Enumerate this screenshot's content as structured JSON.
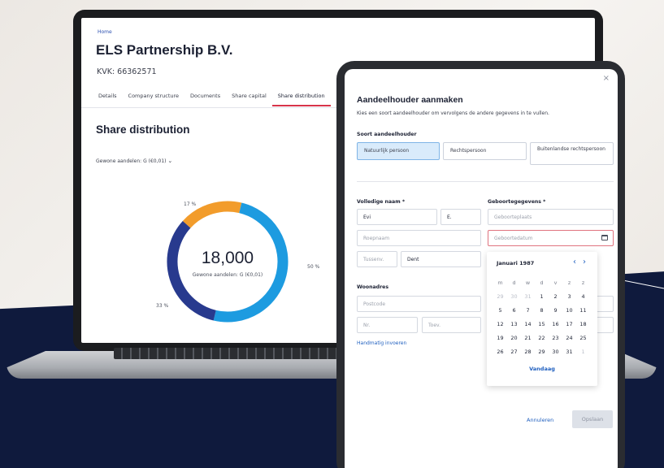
{
  "laptop": {
    "breadcrumb": "Home",
    "company_name": "ELS Partnership B.V.",
    "kvk": "KVK: 66362571",
    "tabs": [
      {
        "label": "Details"
      },
      {
        "label": "Company structure"
      },
      {
        "label": "Documents"
      },
      {
        "label": "Share capital"
      },
      {
        "label": "Share distribution",
        "active": true
      }
    ],
    "section_title": "Share distribution",
    "share_class_select": "Gewone aandelen: G (€0,01)",
    "donut": {
      "total": "18,000",
      "subtitle": "Gewone aandelen: G (€0,01)",
      "segments": [
        {
          "label": "17 %",
          "value": 17,
          "color": "#f29c2b"
        },
        {
          "label": "50 %",
          "value": 50,
          "color": "#1d9be0"
        },
        {
          "label": "33 %",
          "value": 33,
          "color": "#283a8e"
        }
      ]
    }
  },
  "modal": {
    "title": "Aandeelhouder aanmaken",
    "description": "Kies een soort aandeelhouder om vervolgens de andere gegevens in te vullen.",
    "type_label": "Soort aandeelhouder",
    "type_options": [
      {
        "label": "Natuurlijk persoon",
        "active": true
      },
      {
        "label": "Rechtspersoon"
      },
      {
        "label": "Buitenlandse rechtspersoon"
      }
    ],
    "full_name_label": "Volledige naam *",
    "first_name_value": "Evi",
    "initials_value": "E.",
    "surname_placeholder": "Roepnaam",
    "infix_placeholder": "Tussenv.",
    "last_name_value": "Dent",
    "birth_label": "Geboortegegevens *",
    "birthplace_placeholder": "Geboorteplaats",
    "birthdate_placeholder": "Geboortedatum",
    "address_label": "Woonadres",
    "postcode_placeholder": "Postcode",
    "number_placeholder": "Nr.",
    "addition_placeholder": "Toev.",
    "manual_link": "Handmatig invoeren",
    "cancel_label": "Annuleren",
    "save_label": "Opslaan",
    "close_glyph": "×"
  },
  "calendar": {
    "month": "Januari 1987",
    "prev_glyph": "‹",
    "next_glyph": "›",
    "weekdays": [
      "m",
      "d",
      "w",
      "d",
      "v",
      "z",
      "z"
    ],
    "weeks": [
      [
        "29",
        "30",
        "31",
        "1",
        "2",
        "3",
        "4"
      ],
      [
        "5",
        "6",
        "7",
        "8",
        "9",
        "10",
        "11"
      ],
      [
        "12",
        "13",
        "14",
        "15",
        "16",
        "17",
        "18"
      ],
      [
        "19",
        "20",
        "21",
        "22",
        "23",
        "24",
        "25"
      ],
      [
        "26",
        "27",
        "28",
        "29",
        "30",
        "31",
        "1"
      ]
    ],
    "muted_first_week": [
      0,
      1,
      2
    ],
    "muted_last_week": [
      6
    ],
    "today_label": "Vandaag"
  }
}
